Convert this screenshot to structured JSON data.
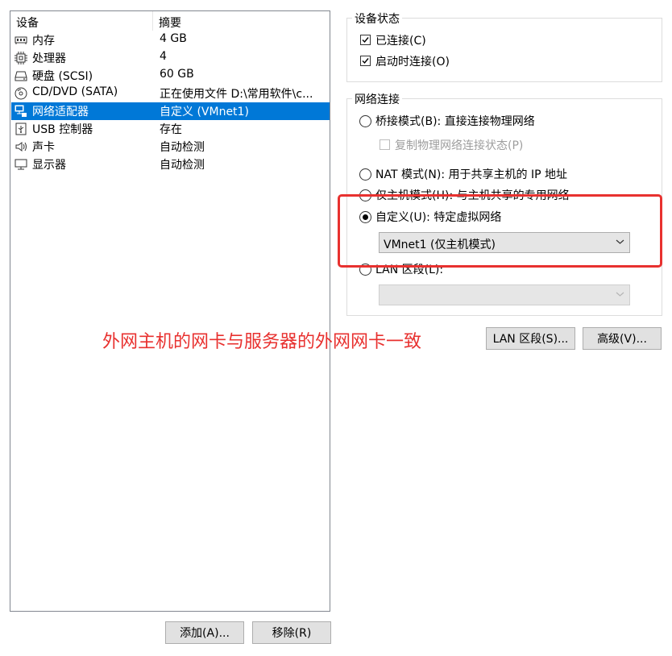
{
  "devices_panel": {
    "col_device": "设备",
    "col_summary": "摘要",
    "items": [
      {
        "name": "内存",
        "summary": "4 GB",
        "icon": "memory-icon"
      },
      {
        "name": "处理器",
        "summary": "4",
        "icon": "cpu-icon"
      },
      {
        "name": "硬盘 (SCSI)",
        "summary": "60 GB",
        "icon": "hard-disk-icon"
      },
      {
        "name": "CD/DVD (SATA)",
        "summary": "正在使用文件 D:\\常用软件\\c...",
        "icon": "cd-dvd-icon"
      },
      {
        "name": "网络适配器",
        "summary": "自定义 (VMnet1)",
        "icon": "network-adapter-icon"
      },
      {
        "name": "USB 控制器",
        "summary": "存在",
        "icon": "usb-icon"
      },
      {
        "name": "声卡",
        "summary": "自动检测",
        "icon": "speaker-icon"
      },
      {
        "name": "显示器",
        "summary": "自动检测",
        "icon": "monitor-icon"
      }
    ],
    "selected_index": 4,
    "add_button": "添加(A)...",
    "remove_button": "移除(R)"
  },
  "device_status": {
    "title": "设备状态",
    "connected": {
      "label": "已连接(C)",
      "checked": true
    },
    "connect_at_power_on": {
      "label": "启动时连接(O)",
      "checked": true
    }
  },
  "network_connection": {
    "title": "网络连接",
    "bridged": {
      "label": "桥接模式(B): 直接连接物理网络",
      "checked": false
    },
    "replicate": {
      "label": "复制物理网络连接状态(P)",
      "checked": false
    },
    "nat": {
      "label": "NAT 模式(N): 用于共享主机的 IP 地址",
      "checked": false
    },
    "host_only": {
      "label": "仅主机模式(H): 与主机共享的专用网络",
      "checked": false
    },
    "custom": {
      "label": "自定义(U): 特定虚拟网络",
      "checked": true
    },
    "custom_select": "VMnet1 (仅主机模式)",
    "lan_segment": {
      "label": "LAN 区段(L):",
      "checked": false
    },
    "lan_select": ""
  },
  "buttons": {
    "lan_segments": "LAN 区段(S)...",
    "advanced": "高级(V)..."
  },
  "annotation": "外网主机的网卡与服务器的外网网卡一致",
  "colors": {
    "selection": "#0078d7",
    "annotation_red": "#e8312f"
  }
}
